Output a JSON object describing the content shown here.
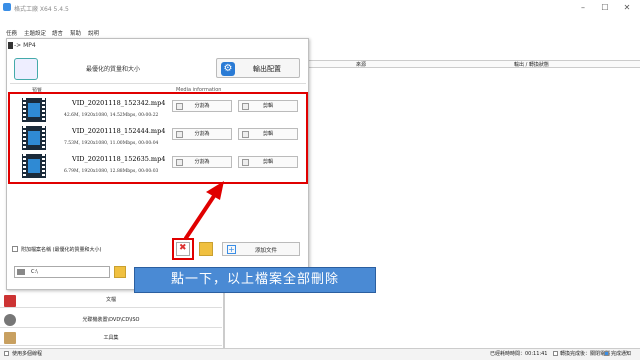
{
  "app": {
    "title": "格式工廠 X64 5.4.5"
  },
  "menu": [
    "任務",
    "主題設定",
    "語言",
    "幫助",
    "說明"
  ],
  "dialog": {
    "title": "-> MP4",
    "quality_label": "最優化的質量和大小",
    "output_config_label": "輸出配置",
    "col_preview": "預覽",
    "col_media": "Media information",
    "files": [
      {
        "name": "VID_20201118_152342.mp4",
        "meta": "42.6M, 1920x1080, 14.52Mbps, 00:00:22"
      },
      {
        "name": "VID_20201118_152444.mp4",
        "meta": "7.53M, 1920x1080, 11.00Mbps, 00:00:04"
      },
      {
        "name": "VID_20201118_152635.mp4",
        "meta": "6.79M, 1920x1080, 12.88Mbps, 00:00:03"
      }
    ],
    "split_label": "分割為",
    "clip_label": "剪輯",
    "add_name_label": "附加檔案名稱 (最優化的質量和大小)",
    "add_file_label": "添加文件",
    "drive_value": "C:\\"
  },
  "bg": {
    "col_source": "來源",
    "col_output": "輸出 / 轉換狀態",
    "left_items": [
      "文檔",
      "光碟機裝置\\DVD\\CD\\ISO",
      "工具集"
    ],
    "status_left": "使用多個線程",
    "status_time_label": "已經耗時時間：00:11:41",
    "status_after_label": "轉換完成後：關閉電腦",
    "status_notify_label": "完成通知"
  },
  "annotation": {
    "tooltip": "點一下，以上檔案全部刪除"
  },
  "colors": {
    "highlight": "#e00000",
    "tooltip_bg": "#4a8ad4",
    "accent": "#3a8ee6"
  }
}
